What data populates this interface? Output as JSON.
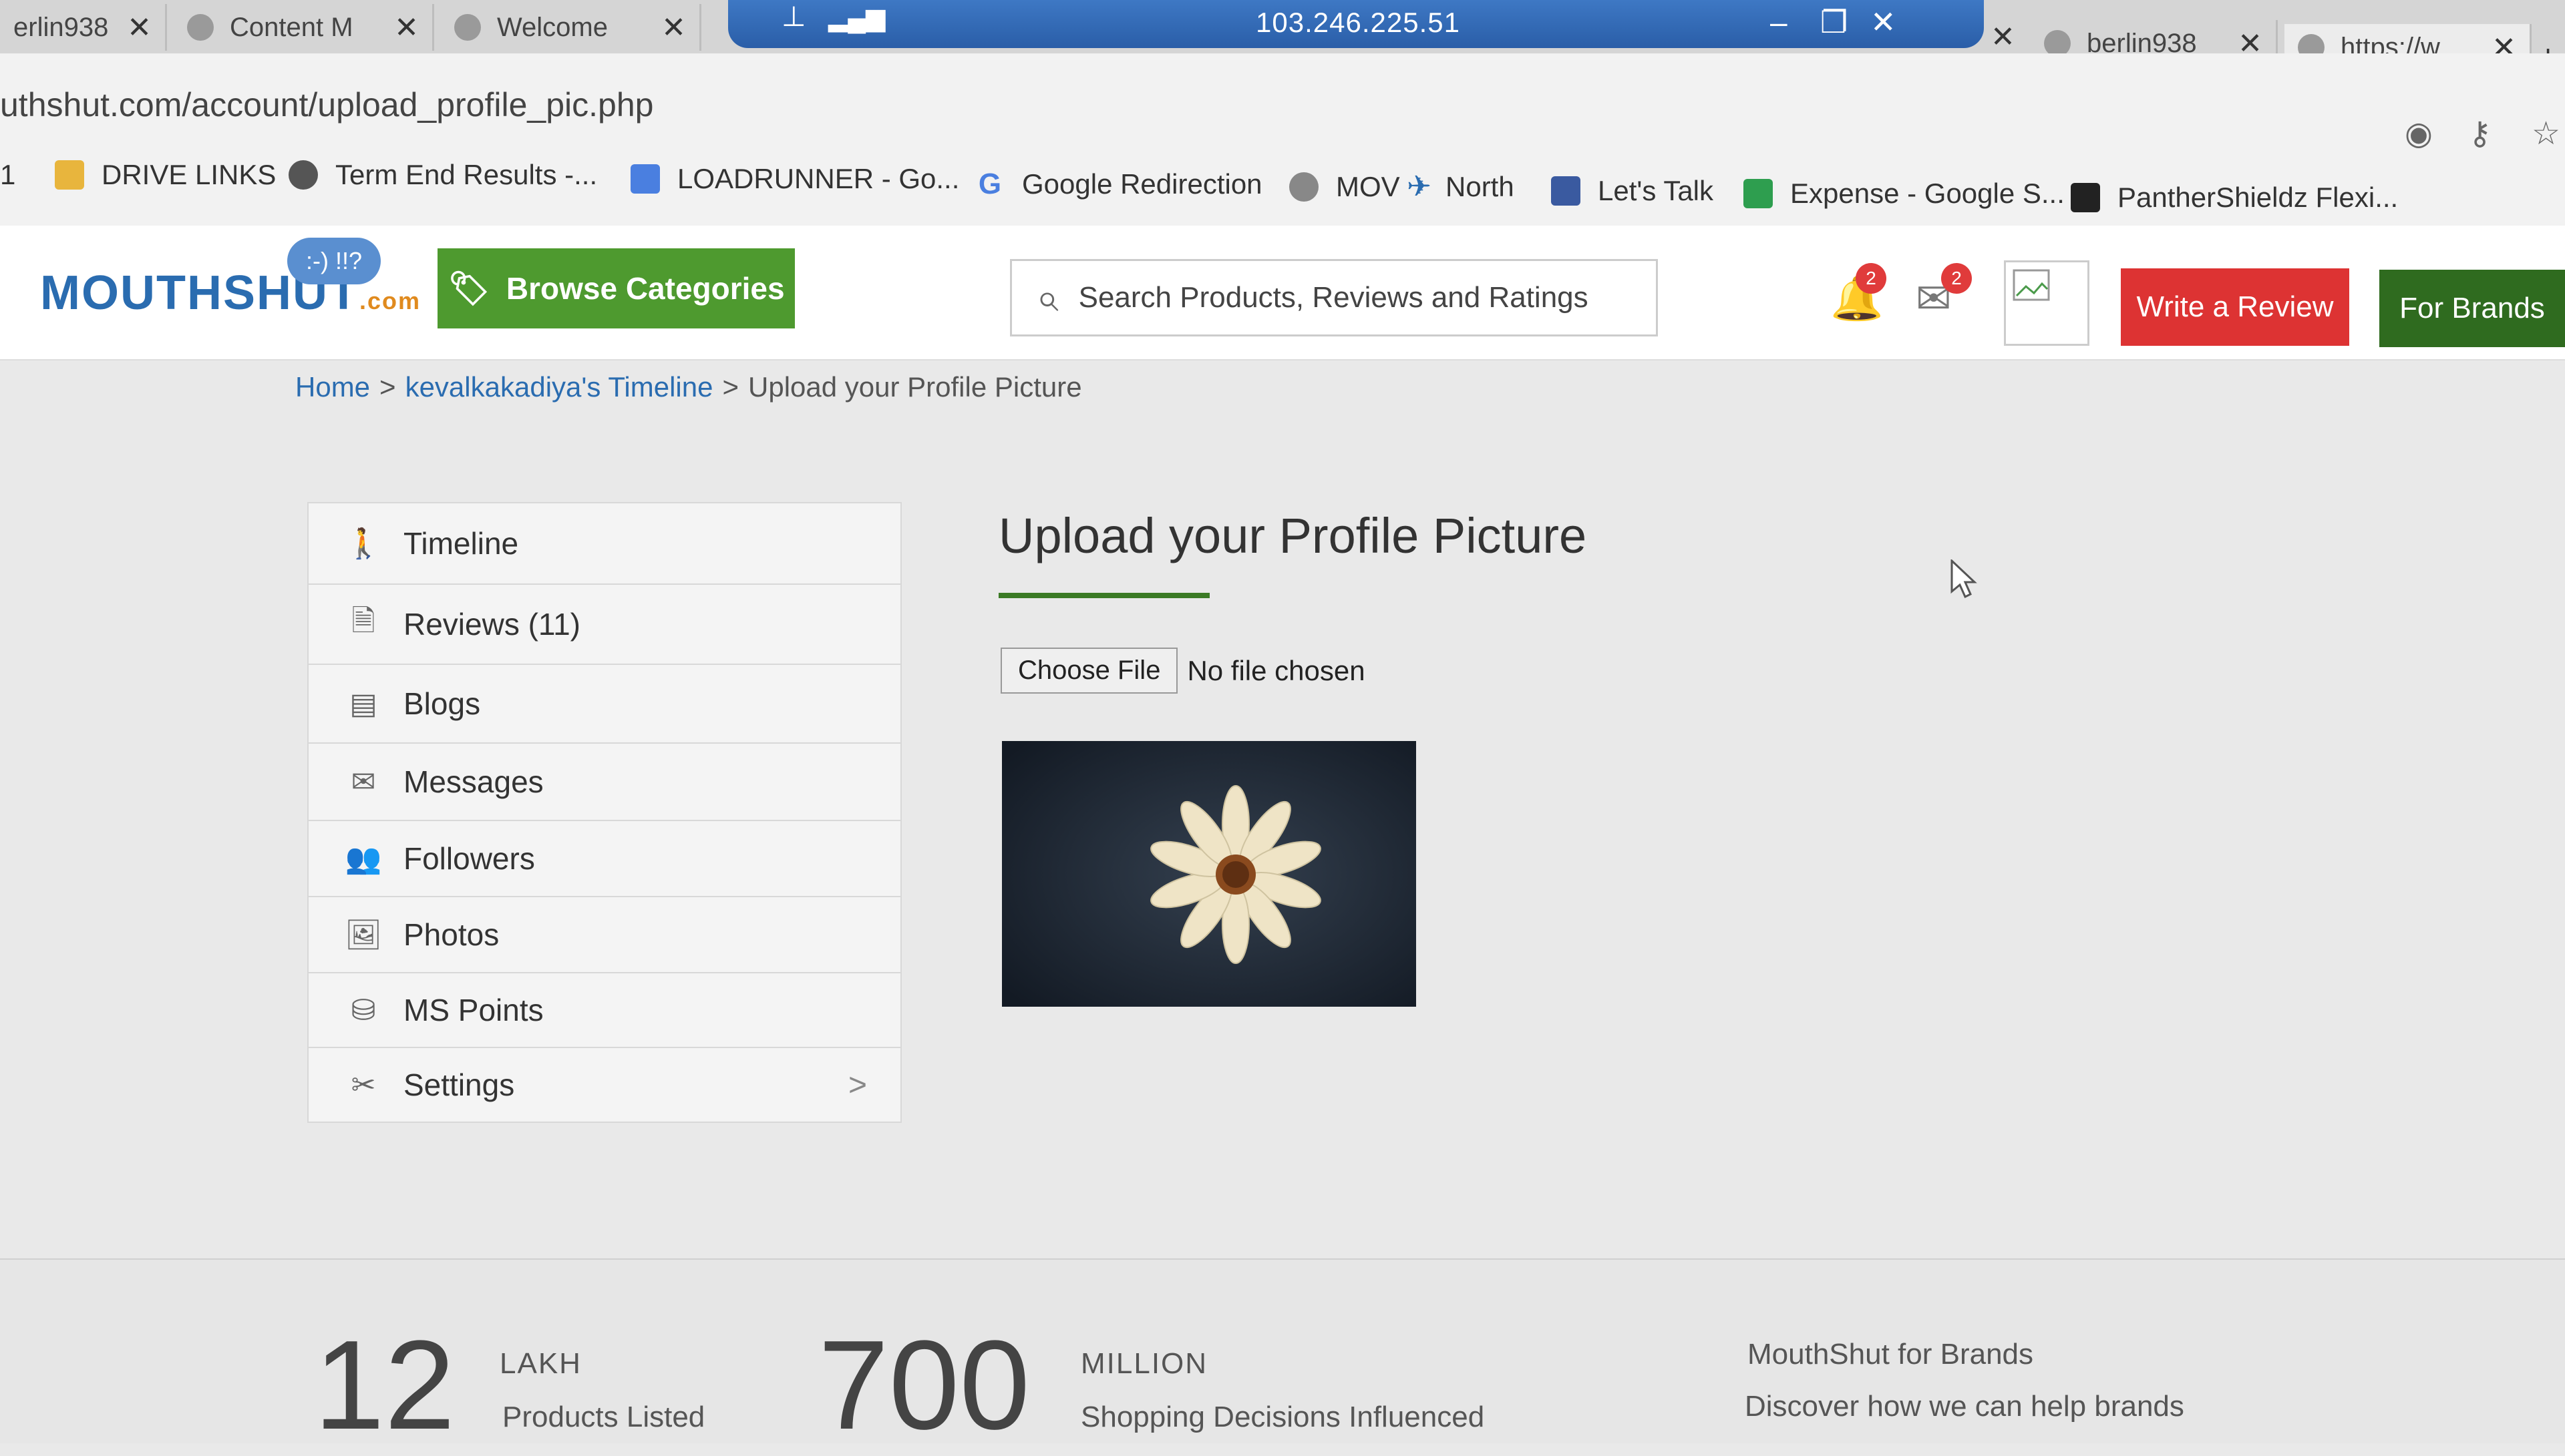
{
  "browser": {
    "tabs": [
      {
        "title": "erlin938"
      },
      {
        "title": "Content M"
      },
      {
        "title": "Welcome"
      },
      {
        "title": "berlin938"
      },
      {
        "title": "https://w"
      }
    ],
    "remote_session": {
      "ip": "103.246.225.51"
    },
    "url": "uthshut.com/account/upload_profile_pic.php",
    "bookmarks": [
      {
        "label": "1",
        "icon": "page-icon"
      },
      {
        "label": "DRIVE LINKS",
        "icon": "folder-icon",
        "color": "#e8b53d"
      },
      {
        "label": "Term End Results -...",
        "icon": "globe-icon",
        "color": "#555555"
      },
      {
        "label": "LOADRUNNER - Go...",
        "icon": "docs-icon",
        "color": "#4a7fe0"
      },
      {
        "label": "Google Redirection",
        "icon": "google-icon",
        "color": "#4a7fe0"
      },
      {
        "label": "MOV",
        "icon": "globe-icon",
        "color": "#888888"
      },
      {
        "label": "North",
        "icon": "plane-icon",
        "color": "#2a6cb0"
      },
      {
        "label": "Let's Talk",
        "icon": "app-icon",
        "color": "#3a5aa0"
      },
      {
        "label": "Expense - Google S...",
        "icon": "sheets-icon",
        "color": "#2e9e4f"
      },
      {
        "label": "PantherShieldz Flexi...",
        "icon": "panther-icon",
        "color": "#222222"
      }
    ]
  },
  "header": {
    "logo": "MOUTHSHUT",
    "logo_suffix": ".com",
    "logo_bubble": ":-) !!?",
    "browse_label": "Browse Categories",
    "search_placeholder": "Search Products, Reviews and Ratings",
    "notification_count": "2",
    "message_count": "2",
    "write_review_label": "Write a Review",
    "for_brands_label": "For Brands"
  },
  "breadcrumb": {
    "home": "Home",
    "timeline": "kevalkakadiya's Timeline",
    "current": "Upload your Profile Picture",
    "separator": ">"
  },
  "sidebar": {
    "items": [
      {
        "label": "Timeline",
        "icon": "walker-icon"
      },
      {
        "label": "Reviews (11)",
        "icon": "document-icon"
      },
      {
        "label": "Blogs",
        "icon": "blog-icon"
      },
      {
        "label": "Messages",
        "icon": "envelope-icon"
      },
      {
        "label": "Followers",
        "icon": "users-icon"
      },
      {
        "label": "Photos",
        "icon": "image-icon"
      },
      {
        "label": "MS Points",
        "icon": "coins-icon"
      },
      {
        "label": "Settings",
        "icon": "tools-icon",
        "chevron": ">"
      }
    ]
  },
  "main": {
    "title": "Upload your Profile Picture",
    "choose_file_label": "Choose File",
    "file_status": "No file chosen"
  },
  "footer": {
    "stat1_number": "12",
    "stat1_unit": "LAKH",
    "stat1_desc": "Products Listed",
    "stat2_number": "700",
    "stat2_unit": "MILLION",
    "stat2_desc": "Shopping Decisions Influenced",
    "brands_title": "MouthShut for Brands",
    "brands_sub": "Discover how we can help brands"
  },
  "colors": {
    "green": "#4e9a2f",
    "dark_green": "#2f6b1f",
    "red": "#dd3333",
    "link_blue": "#2a6cb0"
  }
}
